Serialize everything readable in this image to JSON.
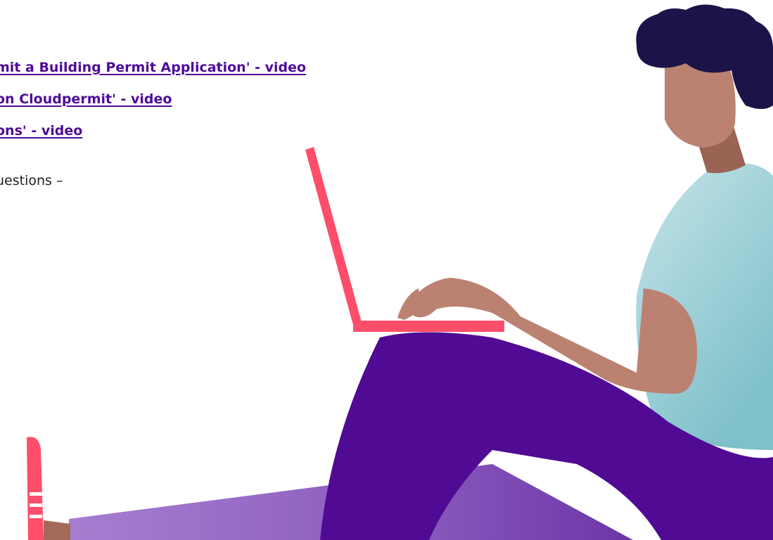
{
  "links": [
    {
      "text": "mit a Building Permit Application' - video"
    },
    {
      "text": "on Cloudpermit' - video"
    },
    {
      "text": "ons' - video"
    }
  ],
  "questions_text": "uestions –",
  "illustration": {
    "name": "person-sitting-with-laptop",
    "colors": {
      "hair": "#1c1448",
      "skin": "#bb8272",
      "skin_shadow": "#9a6454",
      "shirt": "#b9dde2",
      "shirt_shadow": "#86c3cb",
      "pants": "#500a93",
      "laptop": "#ff4d6a",
      "shoe": "#ff4d6a",
      "floor": "#8f60c0",
      "link": "#4f0b97"
    }
  }
}
